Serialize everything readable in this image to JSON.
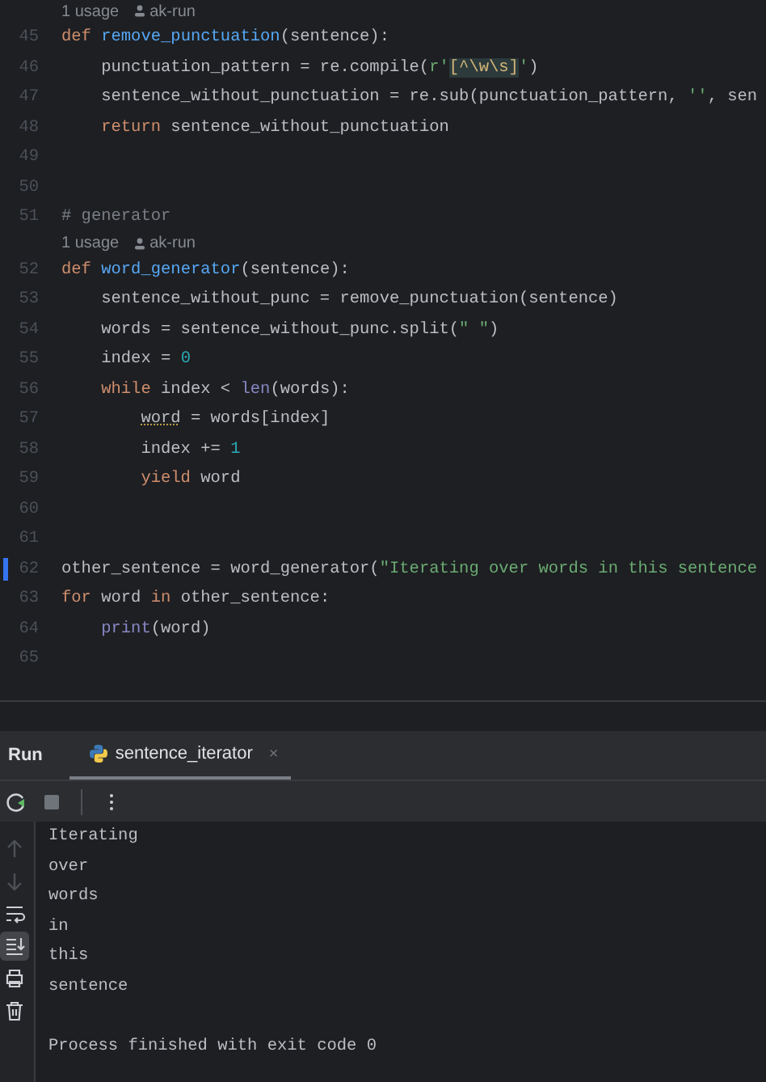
{
  "editor": {
    "lines": [
      {
        "kind": "hint",
        "usages": "1 usage",
        "author": "ak-run"
      },
      {
        "kind": "code",
        "number": "45",
        "modified": false,
        "tokens": [
          {
            "kind": "kw",
            "text": "def "
          },
          {
            "kind": "fn",
            "text": "remove_punctuation"
          },
          {
            "kind": "d",
            "text": "(sentence):"
          }
        ]
      },
      {
        "kind": "code",
        "number": "46",
        "modified": false,
        "tokens": [
          {
            "kind": "d",
            "text": "    punctuation_pattern = re.compile("
          },
          {
            "kind": "str",
            "text": "r'"
          },
          {
            "kind": "rx",
            "text": "[^\\w\\s]"
          },
          {
            "kind": "str",
            "text": "'"
          },
          {
            "kind": "d",
            "text": ")"
          }
        ]
      },
      {
        "kind": "code",
        "number": "47",
        "modified": false,
        "tokens": [
          {
            "kind": "d",
            "text": "    sentence_without_punctuation = re.sub(punctuation_pattern, "
          },
          {
            "kind": "str",
            "text": "''"
          },
          {
            "kind": "d",
            "text": ", sen"
          }
        ]
      },
      {
        "kind": "code",
        "number": "48",
        "modified": false,
        "tokens": [
          {
            "kind": "kw",
            "text": "    return "
          },
          {
            "kind": "d",
            "text": "sentence_without_punctuation"
          }
        ]
      },
      {
        "kind": "code",
        "number": "49",
        "modified": false
      },
      {
        "kind": "code",
        "number": "50",
        "modified": false
      },
      {
        "kind": "code",
        "number": "51",
        "modified": false,
        "tokens": [
          {
            "kind": "cm",
            "text": "# generator"
          }
        ]
      },
      {
        "kind": "hint",
        "usages": "1 usage",
        "author": "ak-run"
      },
      {
        "kind": "code",
        "number": "52",
        "modified": false,
        "tokens": [
          {
            "kind": "kw",
            "text": "def "
          },
          {
            "kind": "fn",
            "text": "word_generator"
          },
          {
            "kind": "d",
            "text": "(sentence):"
          }
        ]
      },
      {
        "kind": "code",
        "number": "53",
        "modified": false,
        "tokens": [
          {
            "kind": "d",
            "text": "    sentence_without_punc = remove_punctuation(sentence)"
          }
        ]
      },
      {
        "kind": "code",
        "number": "54",
        "modified": false,
        "tokens": [
          {
            "kind": "d",
            "text": "    words = sentence_without_punc.split("
          },
          {
            "kind": "str",
            "text": "\" \""
          },
          {
            "kind": "d",
            "text": ")"
          }
        ]
      },
      {
        "kind": "code",
        "number": "55",
        "modified": false,
        "tokens": [
          {
            "kind": "d",
            "text": "    index = "
          },
          {
            "kind": "num",
            "text": "0"
          }
        ]
      },
      {
        "kind": "code",
        "number": "56",
        "modified": false,
        "tokens": [
          {
            "kind": "kw",
            "text": "    while "
          },
          {
            "kind": "d",
            "text": "index < "
          },
          {
            "kind": "bi",
            "text": "len"
          },
          {
            "kind": "d",
            "text": "(words):"
          }
        ]
      },
      {
        "kind": "code",
        "number": "57",
        "modified": false,
        "tokens": [
          {
            "kind": "warn",
            "text": "        word"
          },
          {
            "kind": "d",
            "text": " = words[index]"
          }
        ]
      },
      {
        "kind": "code",
        "number": "58",
        "modified": false,
        "tokens": [
          {
            "kind": "d",
            "text": "        index += "
          },
          {
            "kind": "num",
            "text": "1"
          }
        ]
      },
      {
        "kind": "code",
        "number": "59",
        "modified": false,
        "tokens": [
          {
            "kind": "kw",
            "text": "        yield "
          },
          {
            "kind": "d",
            "text": "word"
          }
        ]
      },
      {
        "kind": "code",
        "number": "60",
        "modified": false
      },
      {
        "kind": "code",
        "number": "61",
        "modified": false
      },
      {
        "kind": "code",
        "number": "62",
        "modified": true,
        "tokens": [
          {
            "kind": "d",
            "text": "other_sentence = word_generator("
          },
          {
            "kind": "str",
            "text": "\"Iterating over words in this sentence"
          }
        ]
      },
      {
        "kind": "code",
        "number": "63",
        "modified": false,
        "tokens": [
          {
            "kind": "kw",
            "text": "for "
          },
          {
            "kind": "d",
            "text": "word "
          },
          {
            "kind": "kw",
            "text": "in "
          },
          {
            "kind": "d",
            "text": "other_sentence:"
          }
        ]
      },
      {
        "kind": "code",
        "number": "64",
        "modified": false,
        "tokens": [
          {
            "kind": "bi",
            "text": "    print"
          },
          {
            "kind": "d",
            "text": "(word)"
          }
        ]
      },
      {
        "kind": "code",
        "number": "65",
        "modified": false
      }
    ]
  },
  "run_panel": {
    "title": "Run",
    "tabs": [
      {
        "label": "sentence_iterator",
        "close": "×",
        "selected": true
      }
    ],
    "toolbar": [
      {
        "kind": "rerun",
        "disabled": false
      },
      {
        "kind": "stop",
        "disabled": true
      },
      {
        "kind": "separator"
      },
      {
        "kind": "more",
        "disabled": false
      }
    ],
    "rail": [
      {
        "kind": "up",
        "disabled": true,
        "selected": false
      },
      {
        "kind": "down",
        "disabled": true,
        "selected": false
      },
      {
        "kind": "wrap",
        "disabled": false,
        "selected": false
      },
      {
        "kind": "scroll-end",
        "disabled": false,
        "selected": true
      },
      {
        "kind": "print",
        "disabled": false,
        "selected": false
      },
      {
        "kind": "trash",
        "disabled": false,
        "selected": false
      }
    ],
    "output": [
      {
        "kind": "stdout",
        "text": "Iterating"
      },
      {
        "kind": "stdout",
        "text": "over"
      },
      {
        "kind": "stdout",
        "text": "words"
      },
      {
        "kind": "stdout",
        "text": "in"
      },
      {
        "kind": "stdout",
        "text": "this"
      },
      {
        "kind": "stdout",
        "text": "sentence"
      },
      {
        "kind": "exit",
        "text": "Process finished with exit code 0"
      }
    ]
  }
}
